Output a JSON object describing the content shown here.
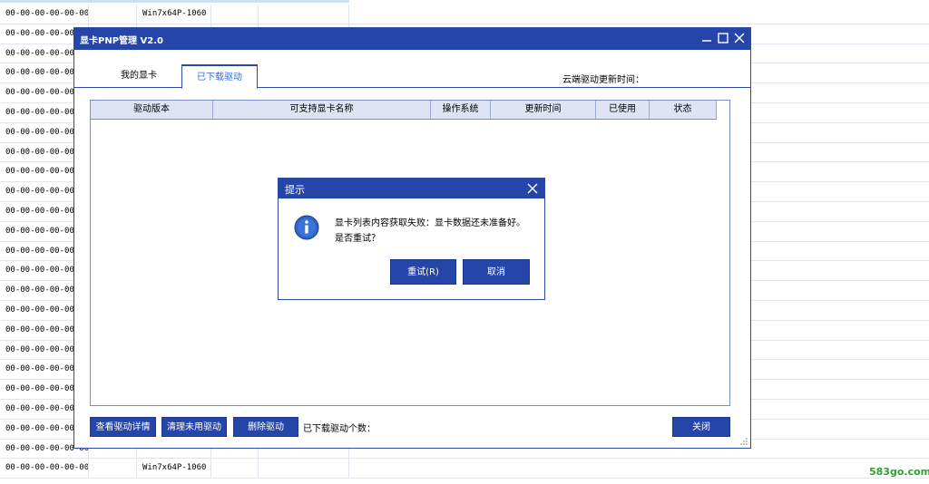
{
  "sheet": {
    "rows": [
      {
        "mac": "00-00-00-00-00-00",
        "os": "Win7x64P-1060"
      },
      {
        "mac": "00-00-00-00-00-00",
        "os": ""
      },
      {
        "mac": "00-00-00-00-00-00",
        "os": ""
      },
      {
        "mac": "00-00-00-00-00-00",
        "os": ""
      },
      {
        "mac": "00-00-00-00-00-00",
        "os": ""
      },
      {
        "mac": "00-00-00-00-00-00",
        "os": ""
      },
      {
        "mac": "00-00-00-00-00-00",
        "os": ""
      },
      {
        "mac": "00-00-00-00-00-00",
        "os": ""
      },
      {
        "mac": "00-00-00-00-00-00",
        "os": ""
      },
      {
        "mac": "00-00-00-00-00-00",
        "os": ""
      },
      {
        "mac": "00-00-00-00-00-00",
        "os": ""
      },
      {
        "mac": "00-00-00-00-00-00",
        "os": ""
      },
      {
        "mac": "00-00-00-00-00-00",
        "os": ""
      },
      {
        "mac": "00-00-00-00-00-00",
        "os": ""
      },
      {
        "mac": "00-00-00-00-00-00",
        "os": ""
      },
      {
        "mac": "00-00-00-00-00-00",
        "os": ""
      },
      {
        "mac": "00-00-00-00-00-00",
        "os": ""
      },
      {
        "mac": "00-00-00-00-00-00",
        "os": ""
      },
      {
        "mac": "00-00-00-00-00-00",
        "os": ""
      },
      {
        "mac": "00-00-00-00-00-00",
        "os": ""
      },
      {
        "mac": "00-00-00-00-00-00",
        "os": ""
      },
      {
        "mac": "00-00-00-00-00-00",
        "os": ""
      },
      {
        "mac": "00-00-00-00-00-00",
        "os": ""
      },
      {
        "mac": "00-00-00-00-00-00",
        "os": "Win7x64P-1060"
      }
    ]
  },
  "window": {
    "title": "显卡PNP管理 V2.0",
    "tabs": [
      "我的显卡",
      "已下载驱动"
    ],
    "active_tab": "已下载驱动",
    "cloud_update_label": "云端驱动更新时间：",
    "columns": [
      "驱动版本",
      "可支持显卡名称",
      "操作系统",
      "更新时间",
      "已使用",
      "状态"
    ],
    "buttons": {
      "details": "查看驱动详情",
      "clean": "清理未用驱动",
      "delete": "删除驱动",
      "close": "关闭"
    },
    "count_label": "已下载驱动个数："
  },
  "dialog": {
    "title": "提示",
    "message_line1": "显卡列表内容获取失败：显卡数据还未准备好。",
    "message_line2": "是否重试？",
    "retry": "重试(R)",
    "cancel": "取消"
  },
  "watermark": "583go.com",
  "colors": {
    "title_bar": "#2545a8",
    "header_bg": "#dfe4f4",
    "active_tab_text": "#2a6be0",
    "watermark": "#30a030"
  }
}
